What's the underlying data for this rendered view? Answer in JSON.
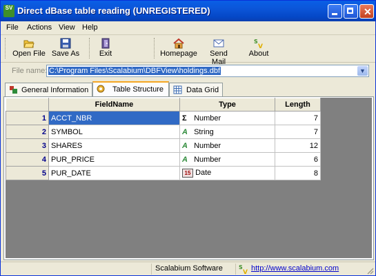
{
  "window": {
    "title": "Direct dBase table reading (UNREGISTERED)",
    "icon": "app-logo-icon"
  },
  "menu": [
    "File",
    "Actions",
    "View",
    "Help"
  ],
  "toolbar": {
    "open": "Open File",
    "save": "Save As",
    "exit": "Exit",
    "homepage": "Homepage",
    "mail": "Send Mail",
    "about": "About"
  },
  "file": {
    "label": "File name:",
    "value": "C:\\Program Files\\Scalabium\\DBFView\\holdings.dbf"
  },
  "tabs": [
    {
      "label": "General Information",
      "icon": "info-icon"
    },
    {
      "label": "Table Structure",
      "icon": "structure-icon",
      "active": true
    },
    {
      "label": "Data Grid",
      "icon": "grid-icon"
    }
  ],
  "table": {
    "headers": [
      "FieldName",
      "Type",
      "Length"
    ],
    "rows": [
      {
        "n": "1",
        "name": "ACCT_NBR",
        "type_icon": "Σ",
        "type": "Number",
        "len": "7"
      },
      {
        "n": "2",
        "name": "SYMBOL",
        "type_icon": "A",
        "type": "String",
        "len": "7"
      },
      {
        "n": "3",
        "name": "SHARES",
        "type_icon": "A",
        "type": "Number",
        "len": "12"
      },
      {
        "n": "4",
        "name": "PUR_PRICE",
        "type_icon": "A",
        "type": "Number",
        "len": "6"
      },
      {
        "n": "5",
        "name": "PUR_DATE",
        "type_icon": "15",
        "type": "Date",
        "len": "8"
      }
    ]
  },
  "status": {
    "company": "Scalabium Software",
    "url": "http://www.scalabium.com"
  },
  "colors": {
    "selection": "#316ac5",
    "title_bar": "#0b55d8",
    "tab_highlight": "#f5a623"
  }
}
